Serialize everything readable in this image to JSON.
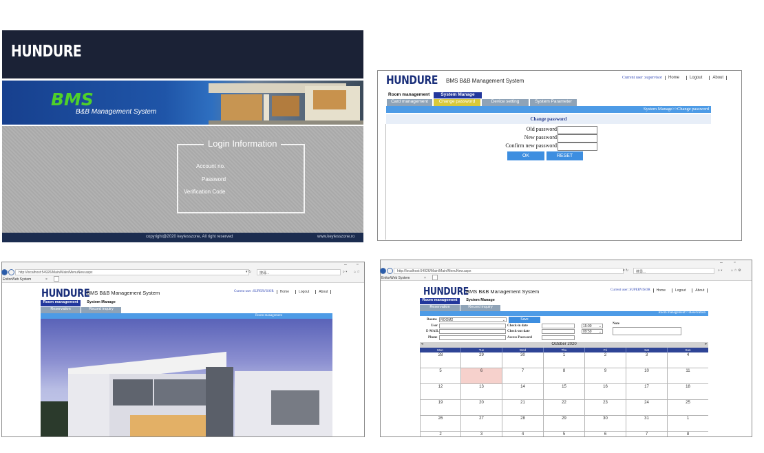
{
  "login": {
    "logo": "HUNDURE",
    "banner_title": "BMS",
    "banner_subtitle": "B&B Management System",
    "box_title": "Login  Information",
    "fields": [
      "Account no.",
      "Password",
      "Verification Code"
    ],
    "copyright": "copyright@2020 keylesszone, All right reserved",
    "site": "www.keylesszone.ro",
    "colors": {
      "header": "#1b2236",
      "banner": "#1f55a8",
      "bms_green": "#4fd02a"
    }
  },
  "change_password": {
    "brand": "HUNDURE",
    "system_name": "BMS B&B Management System",
    "current_user": "Current user :supervisor",
    "links": [
      "Home",
      "Logout",
      "About"
    ],
    "menu": [
      "Room management",
      "System Manage"
    ],
    "submenu": [
      "Card management",
      "Change password",
      "Device setting",
      "System Parameter"
    ],
    "breadcrumb": "System Manage>>Change password",
    "panel_title": "Change password",
    "fields": [
      "Old password",
      "New password",
      "Confirm new password"
    ],
    "buttons": {
      "ok": "OK",
      "reset": "RESET"
    }
  },
  "room_view": {
    "url": "http://localhost:54926/Main/Main/MenuNew.aspx",
    "search_placeholder": "搜尋...",
    "tab_title": "EnitorWeb System",
    "brand": "HUNDURE",
    "system_name": "BMS B&B Management System",
    "current_user": "Current user :SUPERVISOR",
    "links": [
      "Home",
      "Logout",
      "About"
    ],
    "menu": [
      "Room management",
      "System Manage"
    ],
    "submenu": [
      "Reservation",
      "Record inquiry"
    ],
    "breadcrumb": "Room management"
  },
  "reservation": {
    "url": "http://localhost:54926/Main/Main/MenuNew.aspx",
    "search_placeholder": "搜尋...",
    "tab_title": "EnitorWeb System",
    "brand": "HUNDURE",
    "system_name": "BMS B&B Management System",
    "current_user": "Current user :SUPERVISOR",
    "links": [
      "Home",
      "Logout",
      "About"
    ],
    "menu": [
      "Room management",
      "System Manage"
    ],
    "submenu": [
      "Reservation",
      "Record inquiry"
    ],
    "breadcrumb": "Room management>>Reservation",
    "form": {
      "room_label": "Rooms",
      "room_value": "ROOM2",
      "save_button": "Save",
      "user_label": "User",
      "email_label": "E-MAIL",
      "phone_label": "Phone",
      "checkin_label": "Check-in date",
      "checkout_label": "Check-out date",
      "access_label": "Access Password",
      "checkin_time": "15:00",
      "checkout_time": "09:59",
      "note_label": "Note"
    },
    "calendar": {
      "month": "October 2020",
      "days": [
        "Mon",
        "Tue",
        "Wed",
        "Thu",
        "Fri",
        "Sat",
        "Sun"
      ],
      "weeks": [
        [
          "28",
          "29",
          "30",
          "1",
          "2",
          "3",
          "4"
        ],
        [
          "5",
          "6",
          "7",
          "8",
          "9",
          "10",
          "11"
        ],
        [
          "12",
          "13",
          "14",
          "15",
          "16",
          "17",
          "18"
        ],
        [
          "19",
          "20",
          "21",
          "22",
          "23",
          "24",
          "25"
        ],
        [
          "26",
          "27",
          "28",
          "29",
          "30",
          "31",
          "1"
        ],
        [
          "2",
          "3",
          "4",
          "5",
          "6",
          "7",
          "8"
        ]
      ],
      "highlight": "6"
    }
  }
}
